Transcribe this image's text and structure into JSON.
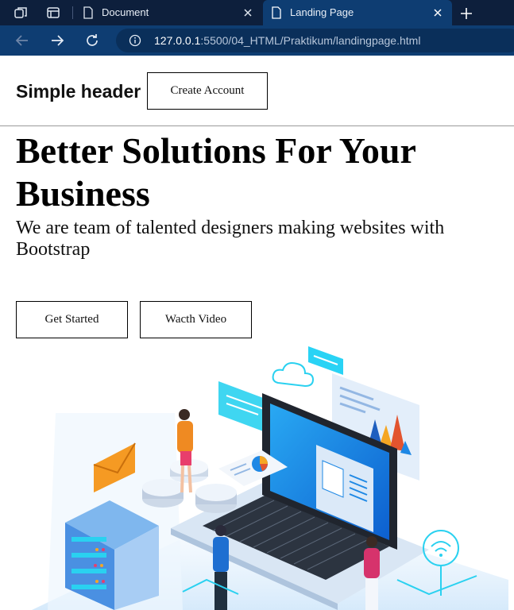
{
  "browser": {
    "tabs": [
      {
        "title": "Document",
        "active": false
      },
      {
        "title": "Landing Page",
        "active": true
      }
    ],
    "url_host": "127.0.0.1",
    "url_path": ":5500/04_HTML/Praktikum/landingpage.html"
  },
  "header": {
    "brand": "Simple header",
    "create_account": "Create Account"
  },
  "hero": {
    "title": "Better Solutions For Your Business",
    "subtitle": "We are team of talented designers making websites with Bootstrap",
    "get_started": "Get Started",
    "watch_video": "Wacth Video"
  },
  "colors": {
    "tabbar": "#0d1f3c",
    "addressbar": "#0e3d72",
    "illustration_blue": "#1e88e5",
    "illustration_cyan": "#29d3f5",
    "illustration_orange": "#f5a623"
  }
}
